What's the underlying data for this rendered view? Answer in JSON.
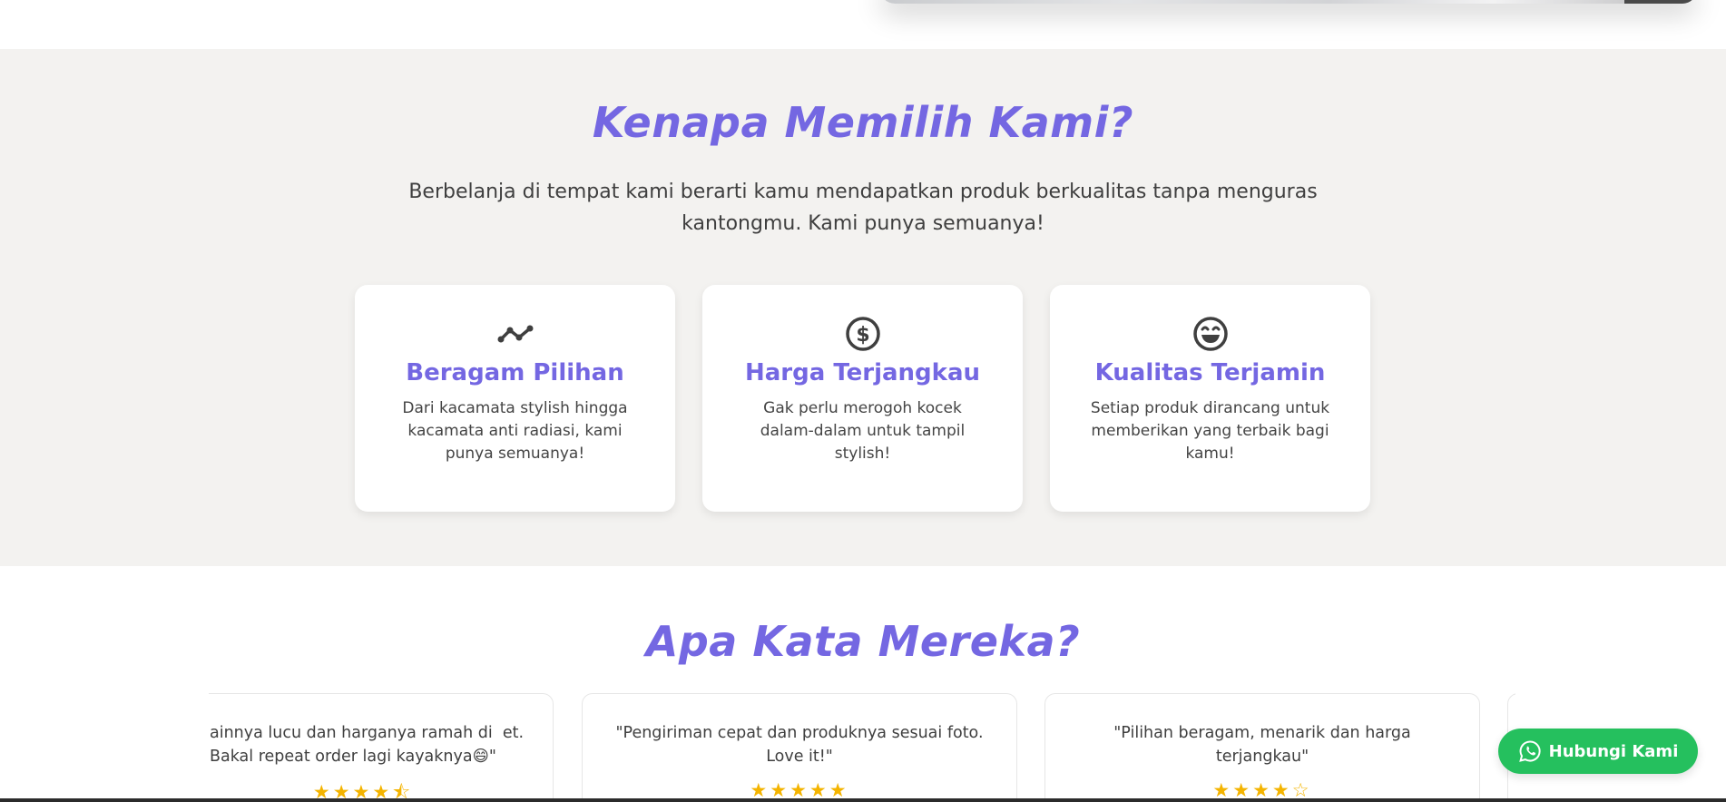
{
  "why_us": {
    "title": "Kenapa Memilih Kami?",
    "subtitle": "Berbelanja di tempat kami berarti kamu mendapatkan produk berkualitas tanpa menguras kantongmu. Kami punya semuanya!",
    "features": [
      {
        "icon": "trend-icon",
        "title": "Beragam Pilihan",
        "text": "Dari kacamata stylish hingga kacamata anti radiasi, kami punya semuanya!"
      },
      {
        "icon": "dollar-icon",
        "title": "Harga Terjangkau",
        "text": "Gak perlu merogoh kocek dalam-dalam untuk tampil stylish!"
      },
      {
        "icon": "smile-icon",
        "title": "Kualitas Terjamin",
        "text": "Setiap produk dirancang untuk memberikan yang terbaik bagi kamu!"
      }
    ]
  },
  "testimonials": {
    "title": "Apa Kata Mereka?",
    "items": [
      {
        "quote": "ainnya lucu dan harganya ramah di  et. Bakal repeat order lagi kayaknya😄\"",
        "stars": "★★★★⯪"
      },
      {
        "quote": "\"Pengiriman cepat dan produknya sesuai foto. Love it!\"",
        "stars": "★★★★★"
      },
      {
        "quote": "\"Pilihan beragam, menarik dan harga terjangkau\"",
        "stars": "★★★★☆"
      }
    ]
  },
  "whatsapp_button": {
    "label": "Hubungi Kami"
  },
  "colors": {
    "accent": "#7467e2",
    "section_bg": "#f3f2f0",
    "whatsapp": "#25c05e",
    "star": "#f4b400"
  }
}
